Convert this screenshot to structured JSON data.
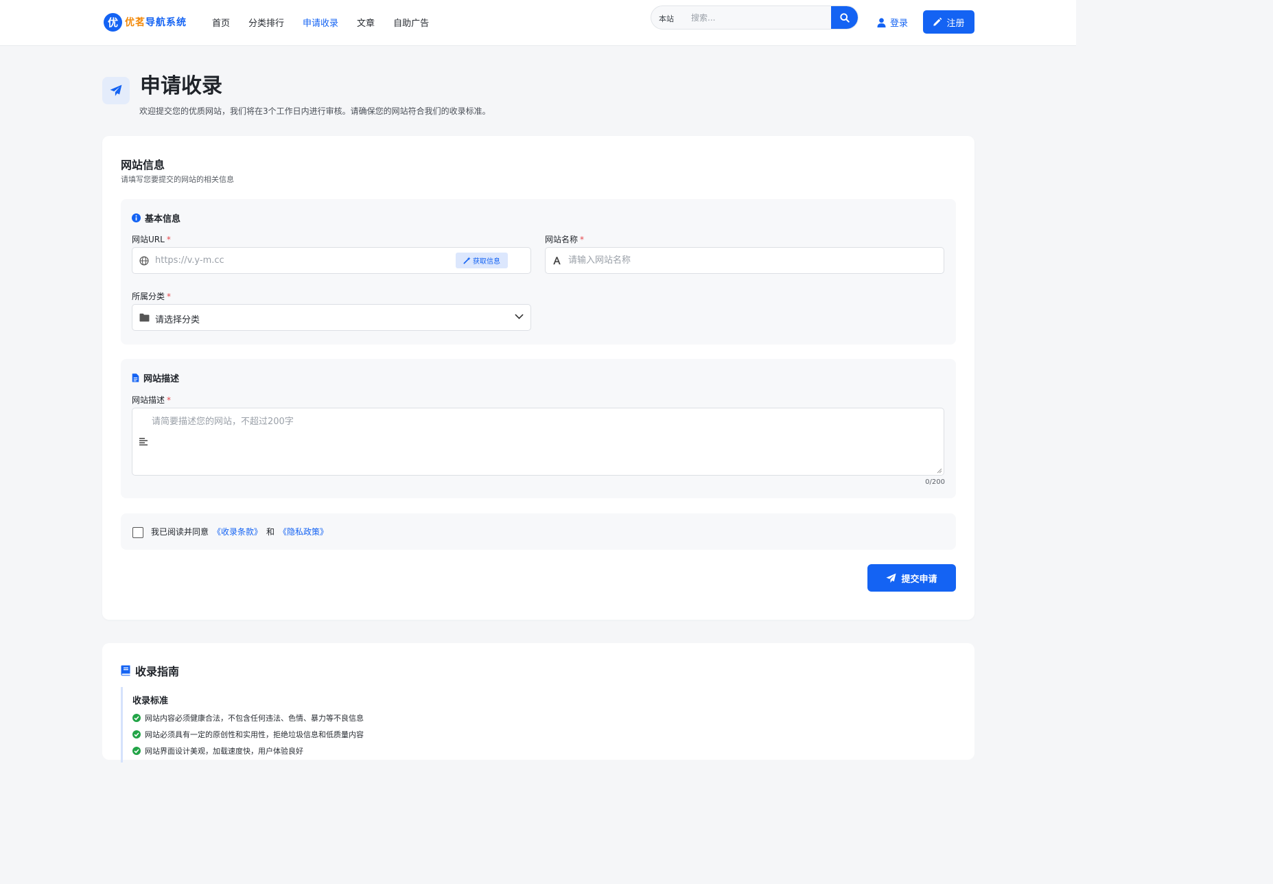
{
  "header": {
    "logo_badge": "优",
    "logo_text_a": "优茗",
    "logo_text_b": "导航",
    "logo_text_c": "系统",
    "nav": [
      {
        "label": "首页",
        "active": false
      },
      {
        "label": "分类排行",
        "active": false
      },
      {
        "label": "申请收录",
        "active": true
      },
      {
        "label": "文章",
        "active": false
      },
      {
        "label": "自助广告",
        "active": false
      }
    ],
    "search_scope": "本站",
    "search_placeholder": "搜索...",
    "login_label": "登录",
    "register_label": "注册"
  },
  "page": {
    "title": "申请收录",
    "subtitle": "欢迎提交您的优质网站，我们将在3个工作日内进行审核。请确保您的网站符合我们的收录标准。"
  },
  "form": {
    "title": "网站信息",
    "subtitle": "请填写您要提交的网站的相关信息",
    "basic": {
      "heading": "基本信息",
      "url_label": "网站URL",
      "url_placeholder": "https://v.y-m.cc",
      "fetch_label": "获取信息",
      "name_label": "网站名称",
      "name_placeholder": "请输入网站名称",
      "category_label": "所属分类",
      "category_value": "请选择分类",
      "required_mark": "*"
    },
    "desc": {
      "heading": "网站描述",
      "label": "网站描述",
      "placeholder": "请简要描述您的网站，不超过200字",
      "counter": "0/200"
    },
    "agree": {
      "prefix": "我已阅读并同意",
      "terms": "《收录条款》",
      "and": "和",
      "privacy": "《隐私政策》"
    },
    "submit_label": "提交申请"
  },
  "guide": {
    "title": "收录指南",
    "subtitle": "收录标准",
    "items": [
      "网站内容必须健康合法，不包含任何违法、色情、暴力等不良信息",
      "网站必须具有一定的原创性和实用性，拒绝垃圾信息和低质量内容",
      "网站界面设计美观，加载速度快，用户体验良好"
    ]
  },
  "colors": {
    "primary": "#1463f3",
    "accent_orange": "#f28a0b",
    "success": "#22a447",
    "required": "#e5484d"
  }
}
